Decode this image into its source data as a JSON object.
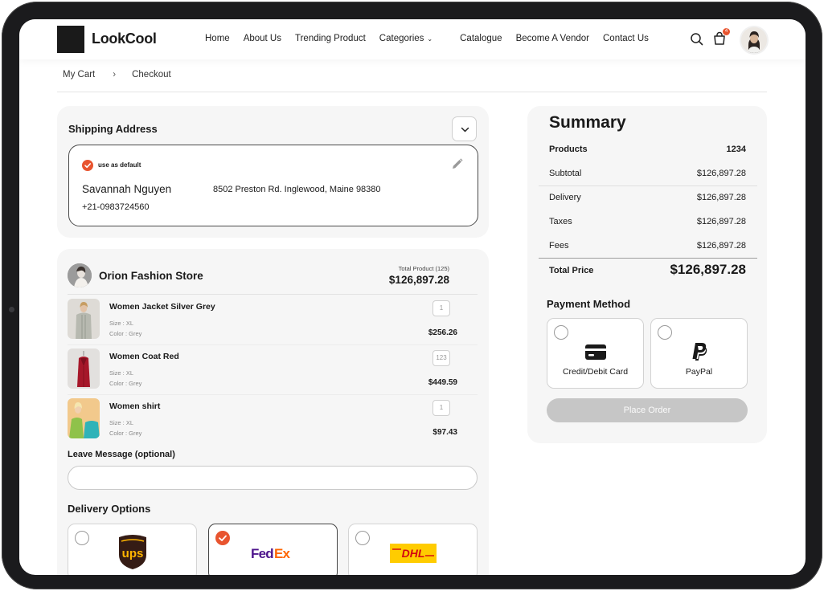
{
  "brand": {
    "name": "LookCool"
  },
  "nav": {
    "items": [
      "Home",
      "About Us",
      "Trending Product",
      "Categories",
      "Catalogue",
      "Become A Vendor",
      "Contact Us"
    ],
    "cart_badge": "4"
  },
  "breadcrumb": {
    "items": [
      "My Cart",
      "Checkout"
    ]
  },
  "shipping": {
    "title": "Shipping Address",
    "default_label": "use as default",
    "name": "Savannah Nguyen",
    "address": "8502 Preston Rd. Inglewood, Maine 98380",
    "phone": "+21-0983724560"
  },
  "store": {
    "name": "Orion Fashion Store",
    "total_label": "Total Product (125)",
    "total_value": "$126,897.28"
  },
  "items": [
    {
      "name": "Women Jacket Silver Grey",
      "size": "Size :  XL",
      "color": "Color :  Grey",
      "qty": "1",
      "price": "$256.26"
    },
    {
      "name": "Women Coat Red",
      "size": "Size :  XL",
      "color": "Color :  Grey",
      "qty": "123",
      "price": "$449.59"
    },
    {
      "name": "Women shirt",
      "size": "Size :  XL",
      "color": "Color :  Grey",
      "qty": "1",
      "price": "$97.43"
    }
  ],
  "message": {
    "label": "Leave Message (optional)",
    "value": ""
  },
  "delivery": {
    "title": "Delivery Options",
    "options": [
      {
        "name": "UPS",
        "selected": false
      },
      {
        "name": "FedEx",
        "selected": true
      },
      {
        "name": "DHL",
        "selected": false
      }
    ],
    "logo_text": {
      "ups": "ups",
      "fed": "Fed",
      "ex": "Ex",
      "dhl": "DHL"
    }
  },
  "summary": {
    "title": "Summary",
    "products_label": "Products",
    "products_value": "1234",
    "subtotal_label": "Subtotal",
    "subtotal_value": "$126,897.28",
    "delivery_label": "Delivery",
    "delivery_value": "$126,897.28",
    "taxes_label": "Taxes",
    "taxes_value": "$126,897.28",
    "fees_label": "Fees",
    "fees_value": "$126,897.28",
    "total_label": "Total Price",
    "total_value": "$126,897.28"
  },
  "payment": {
    "title": "Payment Method",
    "options": [
      {
        "label": "Credit/Debit Card",
        "icon": "credit-card-icon"
      },
      {
        "label": "PayPal",
        "icon": "paypal-icon"
      }
    ],
    "place_order": "Place Order"
  },
  "colors": {
    "accent": "#e8542f",
    "panel": "#f6f6f6",
    "button_disabled": "#c6c6c6",
    "fedex_purple": "#4d148c",
    "fedex_orange": "#ff6600",
    "dhl_yellow": "#ffcc00",
    "dhl_red": "#d40511",
    "ups_brown": "#351c15",
    "ups_gold": "#ffb500"
  }
}
